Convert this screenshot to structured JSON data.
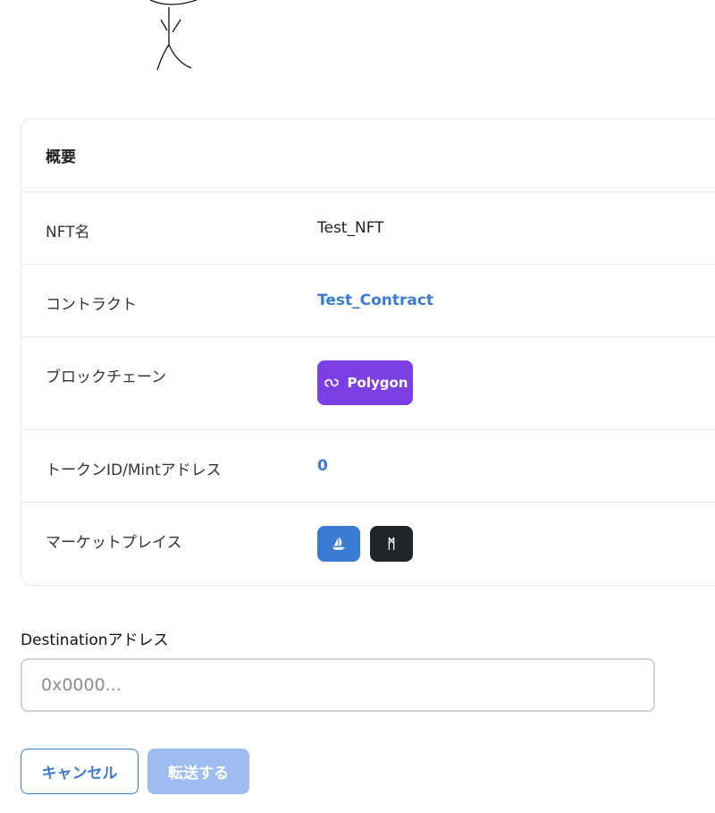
{
  "summary": {
    "title": "概要",
    "rows": {
      "nft_name": {
        "label": "NFT名",
        "value": "Test_NFT"
      },
      "contract": {
        "label": "コントラクト",
        "value": "Test_Contract"
      },
      "blockchain": {
        "label": "ブロックチェーン",
        "value": "Polygon",
        "color": "#7b3fe4"
      },
      "token": {
        "label": "トークンID/Mintアドレス",
        "value": "0"
      },
      "marketplace": {
        "label": "マーケットプレイス",
        "magic_eden_glyph": "ᛗ"
      }
    }
  },
  "destination": {
    "label": "Destinationアドレス",
    "placeholder": "0x0000...",
    "value": ""
  },
  "actions": {
    "cancel_label": "キャンセル",
    "transfer_label": "転送する"
  },
  "colors": {
    "accent": "#3a7bd5",
    "disabled": "#9dbcf0",
    "polygon": "#7b3fe4"
  }
}
